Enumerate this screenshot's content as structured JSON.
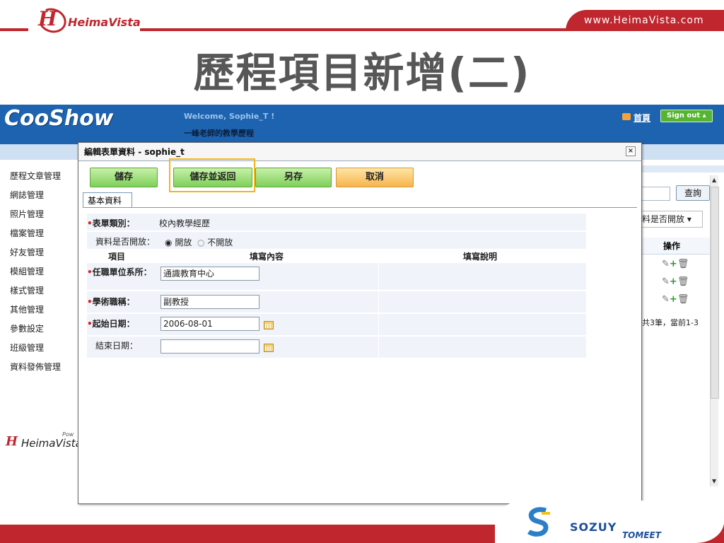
{
  "slide": {
    "url": "www.HeimaVista.com",
    "logo": "HeimaVista",
    "title": "歷程項目新增(二)"
  },
  "app": {
    "logo": "CooShow",
    "welcome": "Welcome, Sophie_T !",
    "subtitle": "一峰老師的教學歷程",
    "home_link": "首頁",
    "signout": "Sign out",
    "sidebar": [
      "歷程文章管理",
      "網誌管理",
      "照片管理",
      "檔案管理",
      "好友管理",
      "模組管理",
      "樣式管理",
      "其他管理",
      "參數設定",
      "班級管理",
      "資料發佈管理"
    ],
    "powered_by": "Pow",
    "powered_logo": "HeimaVista",
    "search_button": "查詢",
    "public_filter": "料是否開放",
    "op_header": "操作",
    "paging": "共3筆，當前1-3"
  },
  "dialog": {
    "title": "編輯表單資料",
    "user": "- sophie_t",
    "close_icon": "close-icon",
    "buttons": {
      "save": "儲存",
      "save_return": "儲存並返回",
      "save_as": "另存",
      "cancel": "取消"
    },
    "highlight_color": "#f3b51b",
    "tab": "基本資料",
    "form": {
      "category_label": "表單類別：",
      "category_value": "校內教學經歷",
      "public_label": "資料是否開放：",
      "public_options": [
        "開放",
        "不開放"
      ],
      "public_selected": "開放",
      "col_item": "項目",
      "col_content": "填寫內容",
      "col_desc": "填寫說明",
      "unit_label": "任職單位系所：",
      "unit_value": "通識教育中心",
      "title_label": "學術職稱：",
      "title_value": "副教授",
      "start_label": "起始日期：",
      "start_value": "2006-08-01",
      "end_label": "結束日期：",
      "end_value": ""
    }
  },
  "sponsors": {
    "logo2": "SOZUY",
    "logo3": "TOMEET"
  }
}
